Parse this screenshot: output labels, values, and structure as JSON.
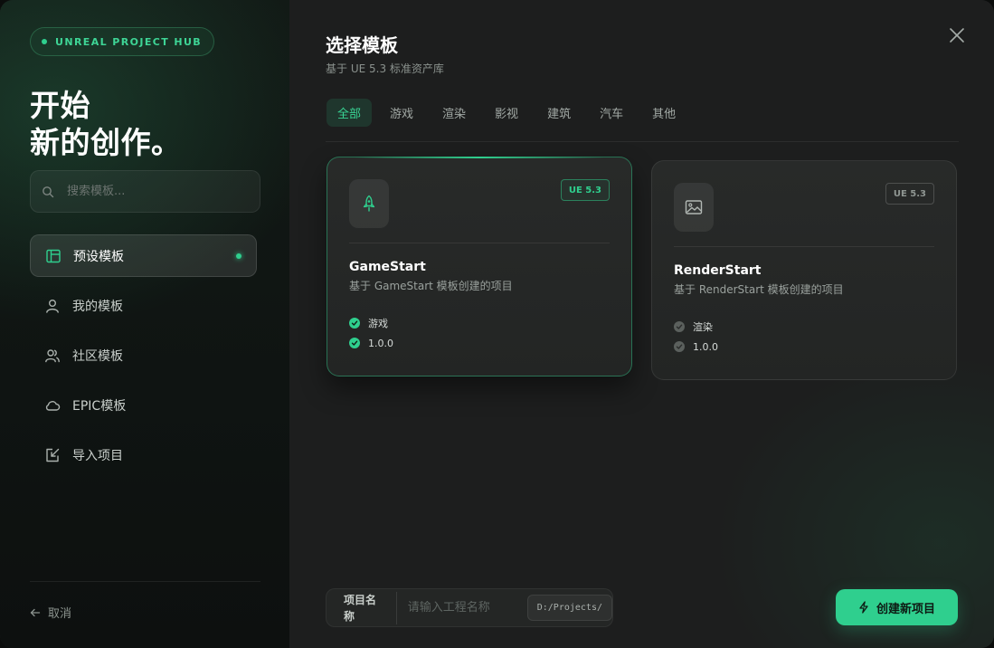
{
  "brand": {
    "label": "UNREAL PROJECT HUB"
  },
  "hero": {
    "line1": "开始",
    "line2": "新的创作。"
  },
  "search": {
    "placeholder": "搜索模板..."
  },
  "nav": {
    "items": [
      {
        "label": "预设模板",
        "icon": "layout-icon",
        "active": true
      },
      {
        "label": "我的模板",
        "icon": "user-icon"
      },
      {
        "label": "社区模板",
        "icon": "users-icon"
      },
      {
        "label": "EPIC模板",
        "icon": "cloud-icon"
      },
      {
        "label": "导入项目",
        "icon": "import-icon"
      }
    ]
  },
  "cancel": {
    "label": "取消"
  },
  "header": {
    "title": "选择模板",
    "subtitle": "基于 UE 5.3 标准资产库"
  },
  "tabs": [
    "全部",
    "游戏",
    "渲染",
    "影视",
    "建筑",
    "汽车",
    "其他"
  ],
  "cards": [
    {
      "name": "GameStart",
      "description": "基于 GameStart 模板创建的项目",
      "badge": "UE 5.3",
      "icon": "rocket-icon",
      "tags": [
        "游戏",
        "1.0.0"
      ],
      "selected": true
    },
    {
      "name": "RenderStart",
      "description": "基于 RenderStart 模板创建的项目",
      "badge": "UE 5.3",
      "icon": "image-icon",
      "tags": [
        "渲染",
        "1.0.0"
      ],
      "selected": false
    }
  ],
  "project": {
    "label": "项目名称",
    "placeholder": "请输入工程名称",
    "path": "D:/Projects/"
  },
  "create_button": {
    "label": "创建新项目"
  },
  "colors": {
    "accent": "#2fcf8e",
    "background": "#1d1e1e",
    "sidebar": "#111714"
  }
}
